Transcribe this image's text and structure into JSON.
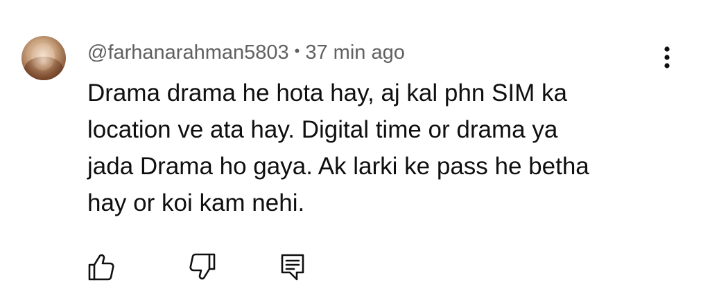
{
  "comment": {
    "author_handle": "@farhanarahman5803",
    "separator": "•",
    "timestamp": "37 min ago",
    "body_lines": [
      "Drama drama he hota hay, aj kal phn SIM ka",
      "location ve ata hay. Digital time or drama ya",
      "jada Drama ho gaya. Ak larki ke pass he betha",
      "hay or koi kam nehi."
    ]
  },
  "icons": {
    "avatar": "avatar",
    "menu": "more-vert-icon",
    "like": "thumb-up-icon",
    "dislike": "thumb-down-icon",
    "reply": "reply-comment-icon"
  },
  "colors": {
    "text_primary": "#0f0f0f",
    "text_secondary": "#606060",
    "background": "#ffffff"
  }
}
